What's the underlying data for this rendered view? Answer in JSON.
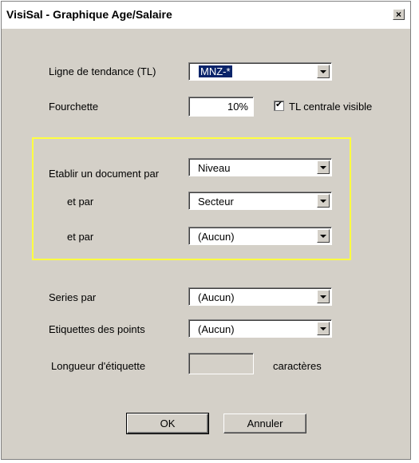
{
  "window": {
    "title": "VisiSal - Graphique Age/Salaire",
    "close_label": "×"
  },
  "trend_line": {
    "label": "Ligne de tendance (TL)",
    "value": "MNZ-*"
  },
  "range": {
    "label": "Fourchette",
    "value": "10%"
  },
  "tl_visible": {
    "label": "TL centrale visible",
    "checked": true
  },
  "document_by": {
    "label": "Etablir un document par",
    "value": "Niveau"
  },
  "and_by_1": {
    "label": "et par",
    "value": "Secteur"
  },
  "and_by_2": {
    "label": "et par",
    "value": "(Aucun)"
  },
  "series_by": {
    "label": "Series par",
    "value": "(Aucun)"
  },
  "point_labels": {
    "label": "Etiquettes des points",
    "value": "(Aucun)"
  },
  "label_length": {
    "label": "Longueur d'étiquette",
    "value": "",
    "unit": "caractères"
  },
  "buttons": {
    "ok": "OK",
    "cancel": "Annuler"
  },
  "colors": {
    "group_border": "#ffff40",
    "face": "#d4d0c8",
    "selection": "#0a246a"
  }
}
